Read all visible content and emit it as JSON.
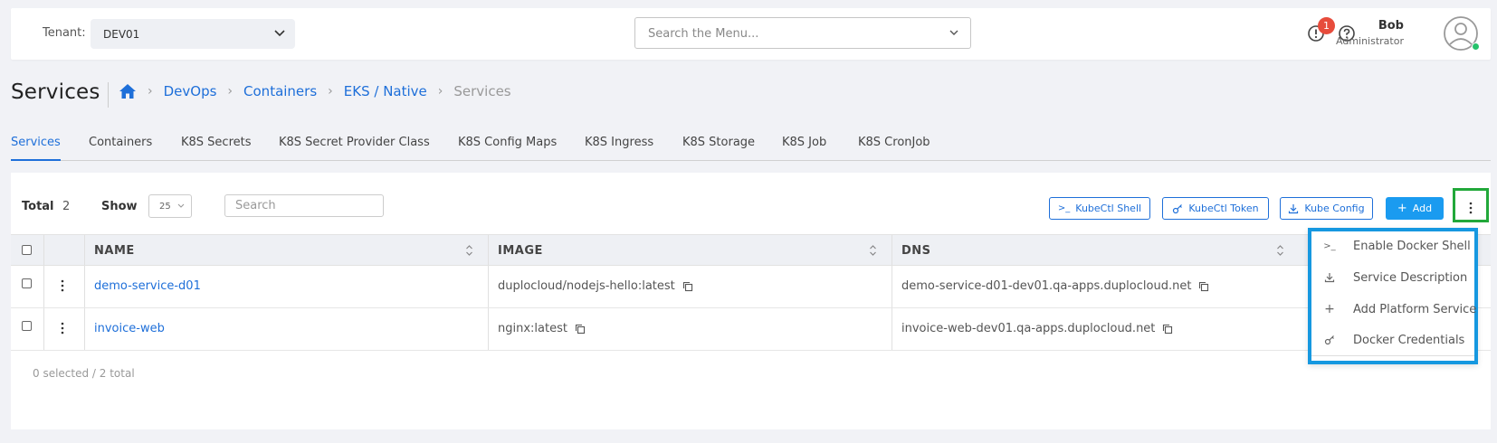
{
  "header": {
    "tenant_label": "Tenant:",
    "tenant_value": "DEV01",
    "menu_search_placeholder": "Search the Menu...",
    "alert_count": "1",
    "user_name": "Bob",
    "user_role": "Administrator"
  },
  "page": {
    "title": "Services",
    "breadcrumb": [
      "DevOps",
      "Containers",
      "EKS / Native",
      "Services"
    ]
  },
  "tabs": [
    "Services",
    "Containers",
    "K8S Secrets",
    "K8S Secret Provider Class",
    "K8S Config Maps",
    "K8S Ingress",
    "K8S Storage",
    "K8S Job",
    "K8S CronJob"
  ],
  "toolbar": {
    "total_label": "Total",
    "total_count": "2",
    "show_label": "Show",
    "show_value": "25",
    "search_placeholder": "Search",
    "kubectl_shell": "KubeCtl Shell",
    "kubectl_token": "KubeCtl Token",
    "kube_config": "Kube Config",
    "add": "Add"
  },
  "table": {
    "columns": [
      "NAME",
      "IMAGE",
      "DNS"
    ],
    "rows": [
      {
        "name": "demo-service-d01",
        "image": "duplocloud/nodejs-hello:latest",
        "dns": "demo-service-d01-dev01.qa-apps.duplocloud.net"
      },
      {
        "name": "invoice-web",
        "image": "nginx:latest",
        "dns": "invoice-web-dev01.qa-apps.duplocloud.net"
      }
    ],
    "footer": "0 selected / 2 total"
  },
  "more_menu": {
    "items": [
      "Enable Docker Shell",
      "Service Description",
      "Add Platform Service",
      "Docker Credentials"
    ]
  },
  "colors": {
    "primary": "#1e6fd9",
    "add_button": "#1a9bf0",
    "highlight_green": "#22a83a",
    "highlight_blue": "#1698e0",
    "alert_red": "#e74c3c"
  }
}
